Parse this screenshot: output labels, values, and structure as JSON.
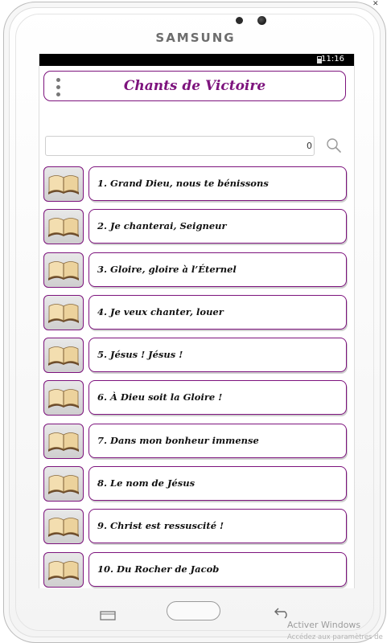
{
  "device": {
    "brand": "SAMSUNG",
    "close_glyph": "✕"
  },
  "status_bar": {
    "time": "11:16",
    "battery_icon": "battery-icon"
  },
  "app": {
    "title": "Chants de Victoire",
    "menu_icon": "overflow-menu-icon"
  },
  "search": {
    "value": "0",
    "icon": "search-icon"
  },
  "songs": [
    {
      "label": "1. Grand Dieu, nous te bénissons",
      "icon": "book-icon"
    },
    {
      "label": "2. Je chanterai, Seigneur",
      "icon": "book-icon"
    },
    {
      "label": "3. Gloire, gloire à l’Éternel",
      "icon": "book-icon"
    },
    {
      "label": "4. Je veux chanter, louer",
      "icon": "book-icon"
    },
    {
      "label": "5. Jésus ! Jésus !",
      "icon": "book-icon"
    },
    {
      "label": "6. À Dieu soit la Gloire !",
      "icon": "book-icon"
    },
    {
      "label": "7. Dans mon bonheur immense",
      "icon": "book-icon"
    },
    {
      "label": "8. Le nom de Jésus",
      "icon": "book-icon"
    },
    {
      "label": "9. Christ est ressuscité !",
      "icon": "book-icon"
    },
    {
      "label": "10. Du Rocher de Jacob",
      "icon": "book-icon"
    }
  ],
  "navigation": {
    "recent": "recent-apps-icon",
    "home": "home-button",
    "back": "back-icon"
  },
  "watermark": {
    "line1": "Activer Windows",
    "line2": "Accédez aux paramètres de"
  },
  "colors": {
    "accent": "#7d137d",
    "status_bar": "#000000"
  }
}
